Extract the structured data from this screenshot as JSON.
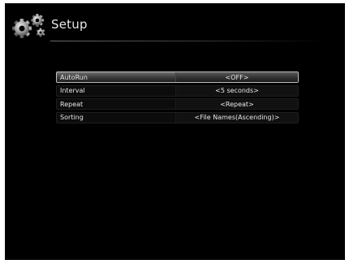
{
  "header": {
    "title": "Setup",
    "icon": "gears-icon"
  },
  "settings": [
    {
      "label": "AutoRun",
      "value": "<OFF>",
      "selected": true
    },
    {
      "label": "Interval",
      "value": "<5 seconds>",
      "selected": false
    },
    {
      "label": "Repeat",
      "value": "<Repeat>",
      "selected": false
    },
    {
      "label": "Sorting",
      "value": "<File Names(Ascending)>",
      "selected": false
    }
  ],
  "colors": {
    "background": "#000000",
    "text": "#e8e8e8",
    "highlight": "#6e6e6e"
  }
}
